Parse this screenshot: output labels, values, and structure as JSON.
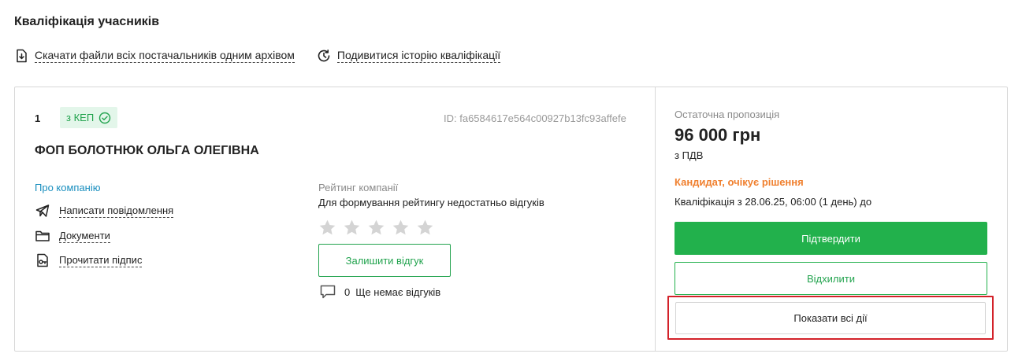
{
  "page": {
    "heading": "Кваліфікація учасників",
    "links": {
      "download_archive": "Скачати файли всіх постачальників одним архівом",
      "history": "Подивитися історію кваліфікації"
    }
  },
  "participant": {
    "number": "1",
    "kep_badge": "з КЕП",
    "id_text": "ID: fa6584617e564c00927b13fc93affefe",
    "company_name": "ФОП БОЛОТНЮК ОЛЬГА ОЛЕГІВНА",
    "about_link": "Про компанію",
    "actions": {
      "message": "Написати повідомлення",
      "documents": "Документи",
      "signature": "Прочитати підпис"
    },
    "rating": {
      "label": "Рейтинг компанії",
      "note": "Для формування рейтингу недостатньо відгуків",
      "stars_filled": 0,
      "stars_total": 5,
      "leave_review": "Залишити відгук",
      "review_count": "0",
      "no_reviews": "Ще немає відгуків"
    }
  },
  "offer": {
    "label": "Остаточна пропозиція",
    "price": "96 000 грн",
    "vat": "з ПДВ",
    "status": "Кандидат, очікує рішення",
    "qualification": "Кваліфікація з 28.06.25, 06:00 (1 день) до",
    "buttons": {
      "confirm": "Підтвердити",
      "reject": "Відхилити",
      "show_all": "Показати всі дії"
    }
  },
  "colors": {
    "accent_green": "#22b14c",
    "status_orange": "#f0802f",
    "link_blue": "#1a8fbf",
    "highlight_red": "#d3222a"
  }
}
